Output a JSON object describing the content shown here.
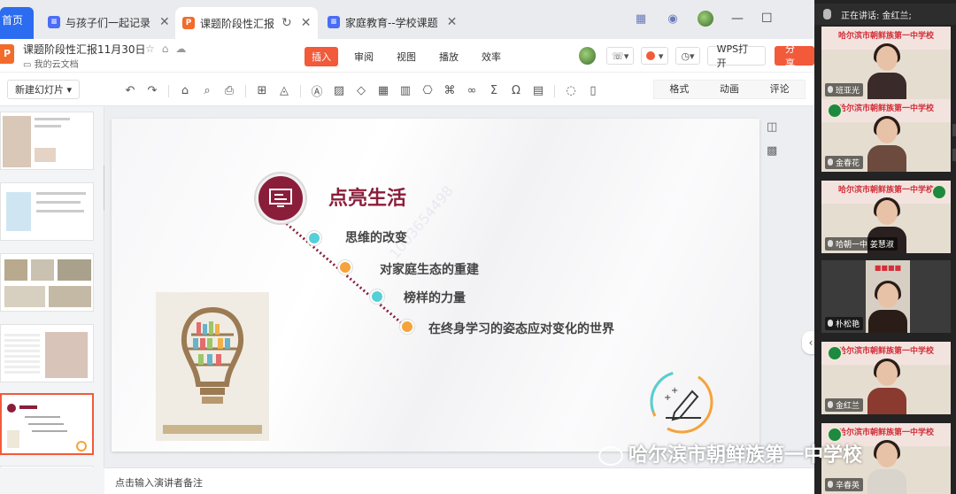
{
  "browser": {
    "home_tab_label": "首页",
    "tabs": [
      {
        "label": "与孩子们一起记录",
        "icon": "W"
      },
      {
        "label": "课题阶段性汇报",
        "icon": "P"
      },
      {
        "label": "家庭教育--学校课题",
        "icon": "W"
      }
    ]
  },
  "doc": {
    "title": "课题阶段性汇报11月30日",
    "location": "我的云文档",
    "menu": [
      "插入",
      "审阅",
      "视图",
      "播放",
      "效率"
    ],
    "active_menu": "插入",
    "wps_open": "WPS打开",
    "share": "分享"
  },
  "toolbar": {
    "new_slide": "新建幻灯片",
    "side_tabs": [
      "格式",
      "动画",
      "评论"
    ]
  },
  "slide": {
    "title": "点亮生活",
    "bullets": [
      {
        "text": "思维的改变",
        "color": "teal"
      },
      {
        "text": "对家庭生态的重建",
        "color": "orange"
      },
      {
        "text": "榜样的力量",
        "color": "teal"
      },
      {
        "text": "在终身学习的姿态应对变化的世界",
        "color": "orange"
      }
    ],
    "watermark": "1003654498"
  },
  "notes_placeholder": "点击输入演讲者备注",
  "meeting": {
    "speaking_label": "正在讲话: 金红兰;",
    "school_banner": "哈尔滨市朝鲜族第一中学校",
    "participants": [
      "班亚光",
      "金春花",
      "哈朝一中 姜慧淑",
      "朴松艳",
      "金红兰",
      "辛春英"
    ]
  },
  "overlay_watermark": "哈尔滨市朝鲜族第一中学校",
  "colors": {
    "accent": "#f25a3a",
    "title_maroon": "#8a1e3a",
    "teal": "#56cfd8",
    "orange": "#f5a33a"
  }
}
